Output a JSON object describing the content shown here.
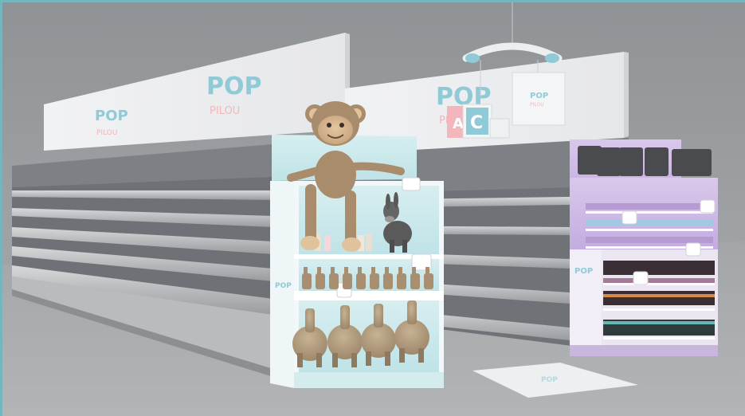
{
  "brand": {
    "name_top": "POP",
    "name_bottom": "PILOU",
    "colors": {
      "blue": "#8fcad6",
      "pink": "#f3b6bc",
      "lavender": "#b79fd3",
      "aqua": "#cfeaec"
    }
  },
  "scene": {
    "description_items": [
      "store-aisle",
      "empty-gondola-shelves",
      "children-toy-display",
      "nail-polish-display",
      "floor-sticker"
    ]
  },
  "hanging_sign": {
    "blocks": [
      "A",
      "C"
    ]
  }
}
